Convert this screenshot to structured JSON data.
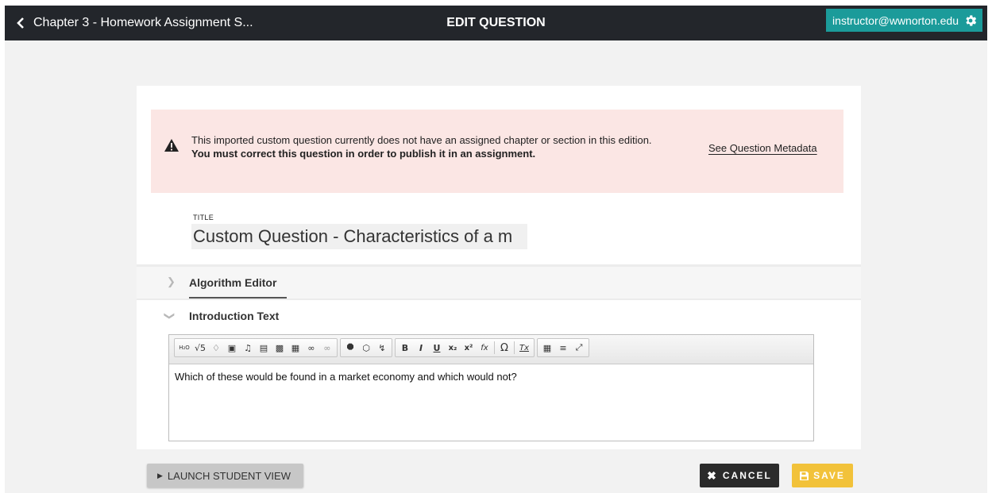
{
  "topbar": {
    "back_label": "Chapter 3 - Homework Assignment S...",
    "page_title": "EDIT QUESTION",
    "user_email": "instructor@wwnorton.edu"
  },
  "alert": {
    "message": "This imported custom question currently does not have an assigned chapter or section in this edition.",
    "message_bold": "You must correct this question in order to publish it in an assignment.",
    "link_label": "See Question Metadata"
  },
  "question": {
    "title_label": "TITLE",
    "title_value": "Custom Question - Characteristics of a m"
  },
  "sections": {
    "algorithm_editor": "Algorithm Editor",
    "introduction_text": "Introduction Text"
  },
  "editor": {
    "content": "Which of these would be found in a market economy and which would not?",
    "toolbar_glyphs": {
      "h2o": "H₂O",
      "sqrt": "√5",
      "bold": "B",
      "italic": "I",
      "underline": "U",
      "subscript": "x₂",
      "superscript": "x²",
      "formula": "fx",
      "omega": "Ω",
      "clear_format": "Tx"
    }
  },
  "footer": {
    "launch_label": "LAUNCH STUDENT VIEW",
    "cancel_label": "CANCEL",
    "save_label": "SAVE"
  },
  "colors": {
    "topbar_bg": "#23262b",
    "user_badge": "#1b9b9a",
    "alert_bg": "#fbe6e4",
    "save_button": "#f2c23a",
    "cancel_button": "#2b2b2b"
  }
}
